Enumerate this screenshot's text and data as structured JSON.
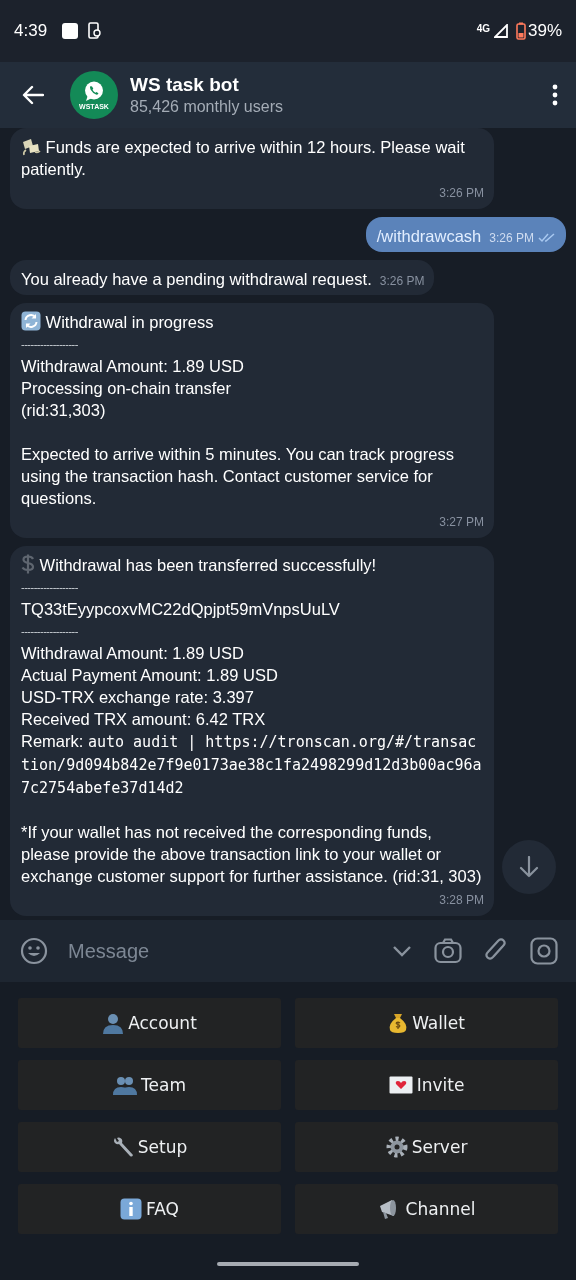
{
  "status_bar": {
    "time": "4:39",
    "network": "4G",
    "battery": "39%"
  },
  "header": {
    "avatar_label": "WSTASK",
    "title": "WS task bot",
    "subtitle": "85,426 monthly users"
  },
  "messages": [
    {
      "kind": "incoming",
      "blocks": [
        {
          "kind": "heading",
          "text": "Funds are expected to arrive within 12 hours. Please wait patiently."
        }
      ],
      "time": "3:26 PM"
    },
    {
      "kind": "outgoing",
      "blocks": [
        {
          "kind": "command",
          "text": "/withdrawcash"
        }
      ],
      "time": "3:26 PM",
      "read": true
    },
    {
      "kind": "incoming",
      "blocks": [
        {
          "kind": "text",
          "text": "You already have a pending withdrawal request."
        }
      ],
      "time": "3:26 PM"
    },
    {
      "kind": "incoming",
      "blocks": [
        {
          "kind": "heading",
          "text": "Withdrawal in progress"
        },
        {
          "kind": "divider",
          "text": "------------------"
        },
        {
          "kind": "text",
          "text": "Withdrawal Amount: 1.89 USD\nProcessing on-chain transfer\n(rid:31,303)"
        },
        {
          "kind": "gap"
        },
        {
          "kind": "text",
          "text": "Expected to arrive within 5 minutes. You can track progress using the transaction hash. Contact customer service for questions."
        }
      ],
      "time": "3:27 PM"
    },
    {
      "kind": "incoming",
      "blocks": [
        {
          "kind": "heading",
          "text": "Withdrawal has been transferred successfully!"
        },
        {
          "kind": "divider",
          "text": "------------------"
        },
        {
          "kind": "text",
          "text": "TQ33tEyypcoxvMC22dQpjpt59mVnpsUuLV"
        },
        {
          "kind": "divider",
          "text": "------------------"
        },
        {
          "kind": "text",
          "text": "Withdrawal Amount: 1.89 USD\nActual Payment Amount: 1.89 USD\nUSD-TRX exchange rate: 3.397\nReceived TRX amount: 6.42 TRX"
        },
        {
          "kind": "remark",
          "text": "Remark:",
          "code": "auto audit | https://tronscan.org/#/transaction/9d094b842e7f9e0173ae38c1fa2498299d12d3b00ac96a7c2754abefe37d14d2"
        },
        {
          "kind": "gap"
        },
        {
          "kind": "text",
          "text": "*If your wallet has not received the corresponding funds, please provide the above transaction link to your wallet or exchange customer support for further assistance. (rid:31, 303)"
        }
      ],
      "time": "3:28 PM"
    }
  ],
  "composer": {
    "placeholder": "Message"
  },
  "keyboard": [
    {
      "label": "Account"
    },
    {
      "label": "Wallet"
    },
    {
      "label": "Team"
    },
    {
      "label": "Invite"
    },
    {
      "label": "Setup"
    },
    {
      "label": "Server"
    },
    {
      "label": "FAQ"
    },
    {
      "label": "Channel"
    }
  ]
}
